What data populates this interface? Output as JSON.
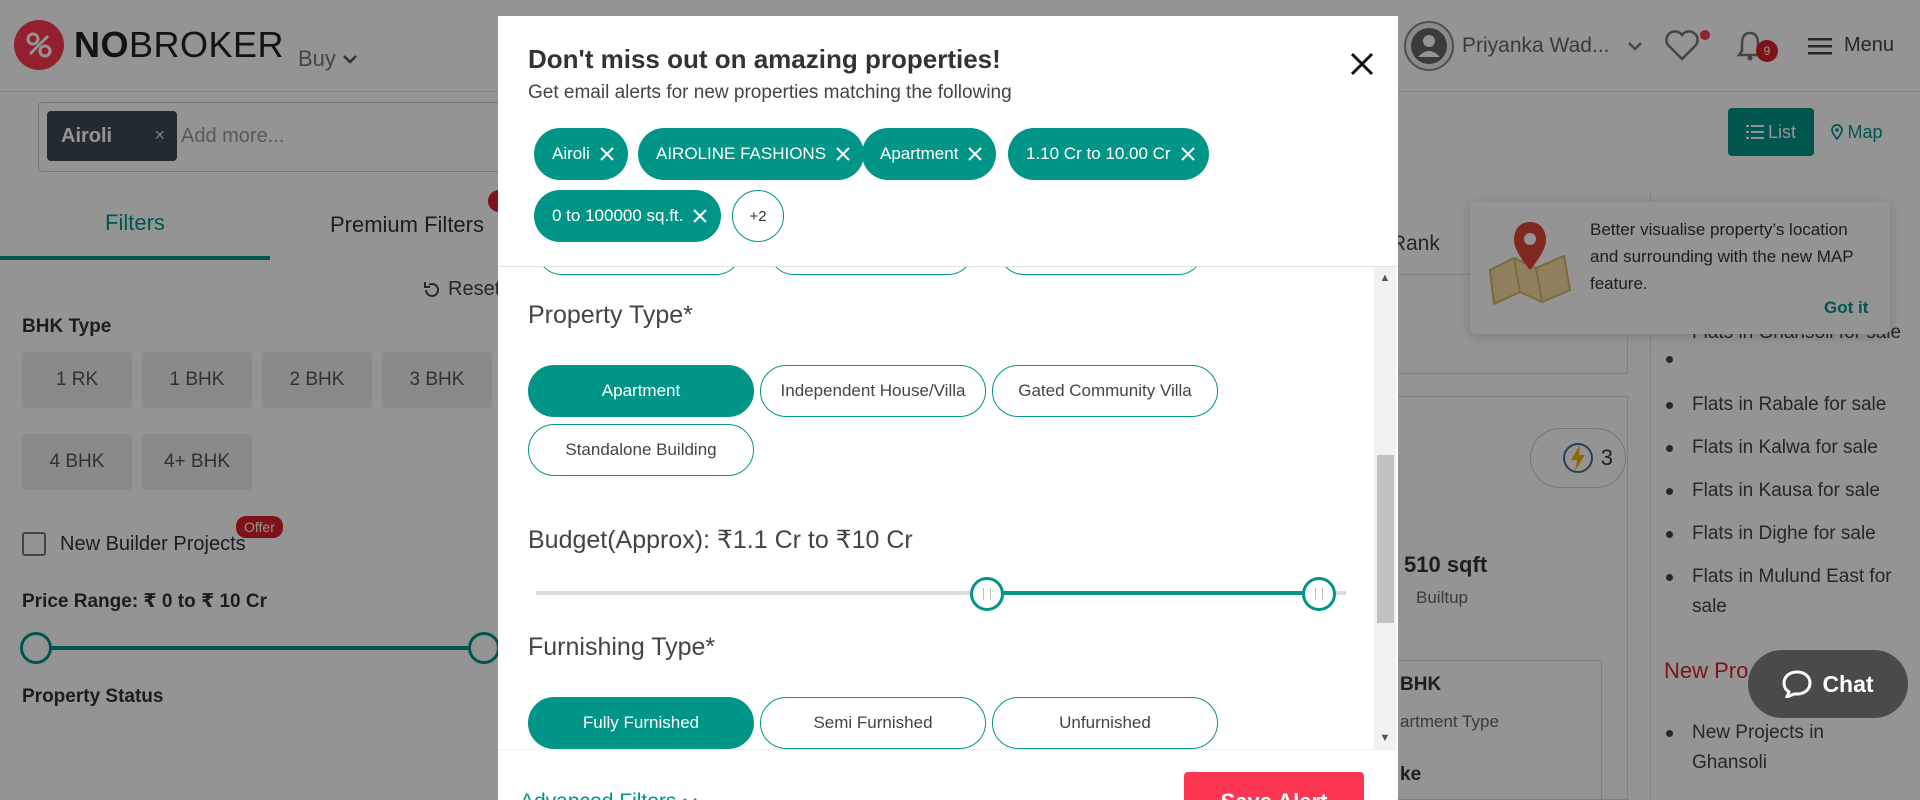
{
  "header": {
    "logo_prefix": "NO",
    "logo_suffix": "BROKER",
    "buy_label": "Buy",
    "user_name": "Priyanka Wad...",
    "notification_count": "9",
    "menu_label": "Menu"
  },
  "search": {
    "selected_location": "Airoli",
    "remove_symbol": "×",
    "placeholder": "Add more..."
  },
  "view_toggle": {
    "list_label": "List",
    "map_label": "Map"
  },
  "filters": {
    "tab_filters": "Filters",
    "tab_premium": "Premium Filters",
    "reset_label": "Reset",
    "bhk_title": "BHK Type",
    "bhk_options": [
      "1 RK",
      "1 BHK",
      "2 BHK",
      "3 BHK",
      "4 BHK",
      "4+ BHK"
    ],
    "new_builder_label": "New Builder Projects",
    "offer_badge": "Offer",
    "price_title": "Price Range: ₹ 0 to ₹ 10 Cr",
    "status_title": "Property Status"
  },
  "listing": {
    "sort_label": "r Rank",
    "power_count": "3",
    "area_value": "510 sqft",
    "area_label": "Builtup",
    "bhk_value": "BHK",
    "type_label": "artment Type",
    "row2_value": "ke"
  },
  "side": {
    "links": [
      "Flats in Ghansoli for sale",
      "Flats in Rabale for sale",
      "Flats in Kalwa for sale",
      "Flats in Kausa for sale",
      "Flats in Dighe for sale",
      "Flats in Mulund East for sale"
    ],
    "new_projects_title": "New Pro",
    "new_project_link": "New Projects in Ghansoli"
  },
  "tooltip": {
    "text": "Better visualise property’s location and surrounding with the new MAP feature.",
    "got_it": "Got it"
  },
  "chat": {
    "label": "Chat"
  },
  "modal": {
    "title": "Don't miss out on amazing properties!",
    "subtitle": "Get email alerts for new properties matching the following",
    "chips": [
      "Airoli",
      "AIROLINE FASHIONS",
      "Apartment",
      "1.10 Cr to 10.00 Cr",
      "0 to 100000 sq.ft."
    ],
    "more_chip": "+2",
    "property_type_title": "Property Type*",
    "property_types": [
      "Apartment",
      "Independent House/Villa",
      "Gated Community Villa",
      "Standalone Building"
    ],
    "property_type_selected": "Apartment",
    "budget_title": "Budget(Approx): ₹1.1 Cr to ₹10 Cr",
    "budget_min_cr": 1.1,
    "budget_max_cr": 10,
    "furnishing_title": "Furnishing Type*",
    "furnishing_types": [
      "Fully Furnished",
      "Semi Furnished",
      "Unfurnished"
    ],
    "furnishing_selected": "Fully Furnished",
    "advanced_filters": "Advanced Filters",
    "save_button": "Save Alert"
  },
  "colors": {
    "primary": "#009587",
    "accent": "#fd3752",
    "badge": "#d91f2a"
  }
}
